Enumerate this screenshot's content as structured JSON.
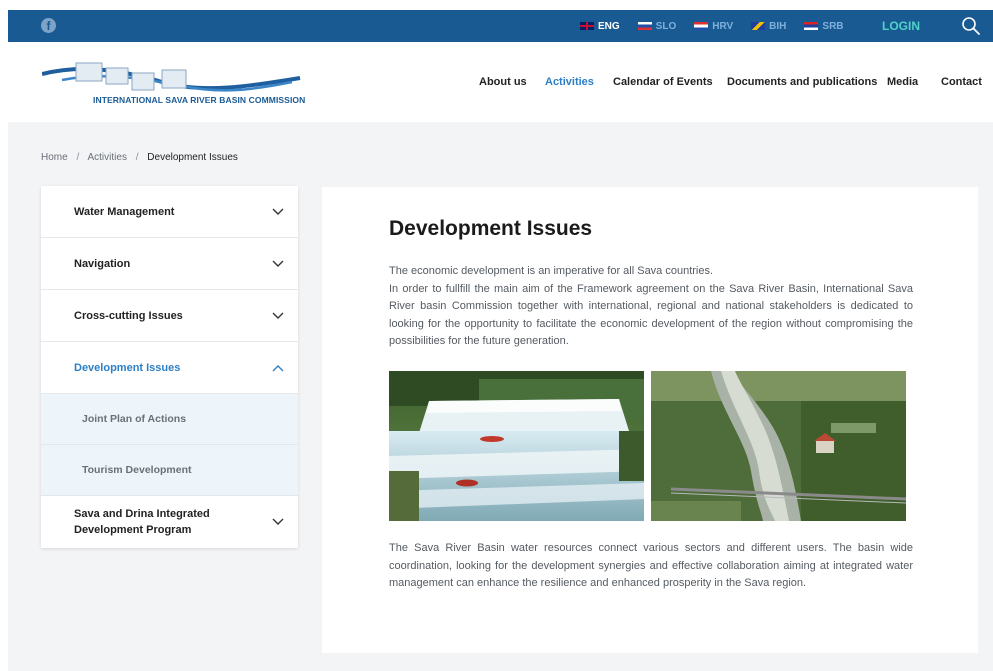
{
  "topbar": {
    "languages": [
      {
        "code": "ENG",
        "active": true
      },
      {
        "code": "SLO",
        "active": false
      },
      {
        "code": "HRV",
        "active": false
      },
      {
        "code": "BIH",
        "active": false
      },
      {
        "code": "SRB",
        "active": false
      }
    ],
    "login_label": "LOGIN",
    "icons": [
      "facebook-icon",
      "search-icon"
    ]
  },
  "header": {
    "logo_text": "INTERNATIONAL SAVA RIVER BASIN COMMISSION",
    "nav": [
      {
        "label": "About us",
        "active": false
      },
      {
        "label": "Activities",
        "active": true
      },
      {
        "label": "Calendar of Events",
        "active": false
      },
      {
        "label": "Documents and publications",
        "active": false
      },
      {
        "label": "Media",
        "active": false
      },
      {
        "label": "Contact",
        "active": false
      }
    ]
  },
  "breadcrumb": {
    "items": [
      "Home",
      "Activities"
    ],
    "separator": "/",
    "current": "Development Issues"
  },
  "sidebar": {
    "items": [
      {
        "label": "Water Management",
        "expanded": false
      },
      {
        "label": "Navigation",
        "expanded": false
      },
      {
        "label": "Cross-cutting Issues",
        "expanded": false
      },
      {
        "label": "Development Issues",
        "expanded": true,
        "children": [
          "Joint Plan of Actions",
          "Tourism Development"
        ]
      },
      {
        "label": "Sava and Drina Integrated Development Program",
        "expanded": false
      }
    ]
  },
  "main": {
    "title": "Development Issues",
    "paragraph1": "The economic development is an imperative for all Sava countries.\nIn order to fullfill the main aim of the Framework agreement on the Sava River Basin, International Sava River basin Commission together with international, regional and national stakeholders is dedicated to looking for the opportunity to facilitate the economic development of the region without compromising the possibilities for the future generation.",
    "paragraph2": "The Sava River Basin water resources connect various sectors and different users. The basin wide coordination, looking for the development synergies and effective collaboration aiming at integrated water management can enhance the resilience and enhanced prosperity in the Sava region."
  },
  "colors": {
    "topbar_bg": "#1a5a93",
    "accent": "#2d7fc6",
    "login": "#4fd2c8",
    "content_bg": "#f3f4f6",
    "submenu_bg": "#eef5fa"
  }
}
